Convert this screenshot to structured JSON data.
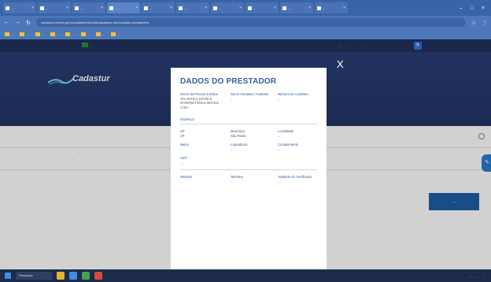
{
  "browser": {
    "tabs": [
      {
        "label": "...",
        "active": false
      },
      {
        "label": "...",
        "active": false
      },
      {
        "label": "...",
        "active": false
      },
      {
        "label": "...",
        "active": true
      },
      {
        "label": "...",
        "active": false
      },
      {
        "label": "...",
        "active": false
      },
      {
        "label": "...",
        "active": false
      },
      {
        "label": "...",
        "active": false
      },
      {
        "label": "...",
        "active": false
      },
      {
        "label": "...",
        "active": false
      }
    ],
    "url": "cadastur.turismo.gov.br/cadastur/#!/public/qualquer-um/consultar-prestadores",
    "bookmarks": [
      "...",
      "...",
      "...",
      "...",
      "...",
      "...",
      "...",
      "..."
    ]
  },
  "page": {
    "brand": "Cadastur",
    "brand_sub": "",
    "gov_label": "...",
    "top_links": [
      "...",
      "...",
      "..."
    ],
    "hero_nav": [
      "...",
      "...",
      "...",
      "..."
    ],
    "filter_rows": [
      {
        "c1": "...",
        "c2": "...",
        "c3": "...",
        "c4": "..."
      },
      {
        "c1": "...",
        "c2": "...",
        "c3": "...",
        "c4": "..."
      }
    ],
    "results_label": "...",
    "action_button": "..."
  },
  "modal": {
    "title": "DADOS DO PRESTADOR",
    "close": "X",
    "identity": {
      "labels": [
        "Nome da Pessoa Jurídica",
        "Nome Fantasia / Fantasia",
        "Número do Cadastro"
      ],
      "values": [
        "ATLANTICA HOTELS INTERNATIONAL BRASIL LTDA",
        "...",
        "..."
      ]
    },
    "address_section": "Endereço",
    "address_row1": {
      "labels": [
        "UF",
        "Município",
        "Localidade"
      ],
      "values": [
        "SP",
        "São Paulo",
        "..."
      ]
    },
    "address_row2": {
      "labels": [
        "Bairro",
        "Logradouro",
        "Complemento"
      ],
      "values": [
        "...",
        "...",
        "..."
      ]
    },
    "cep": {
      "label": "CEP",
      "value": "..."
    },
    "table": {
      "headers": [
        "Website",
        "Telefone",
        "Validade do Certificado"
      ],
      "row": [
        "...",
        "...",
        "..."
      ]
    }
  },
  "taskbar": {
    "search": "Pesquisar",
    "tray": [
      "...",
      "...",
      "..."
    ]
  }
}
